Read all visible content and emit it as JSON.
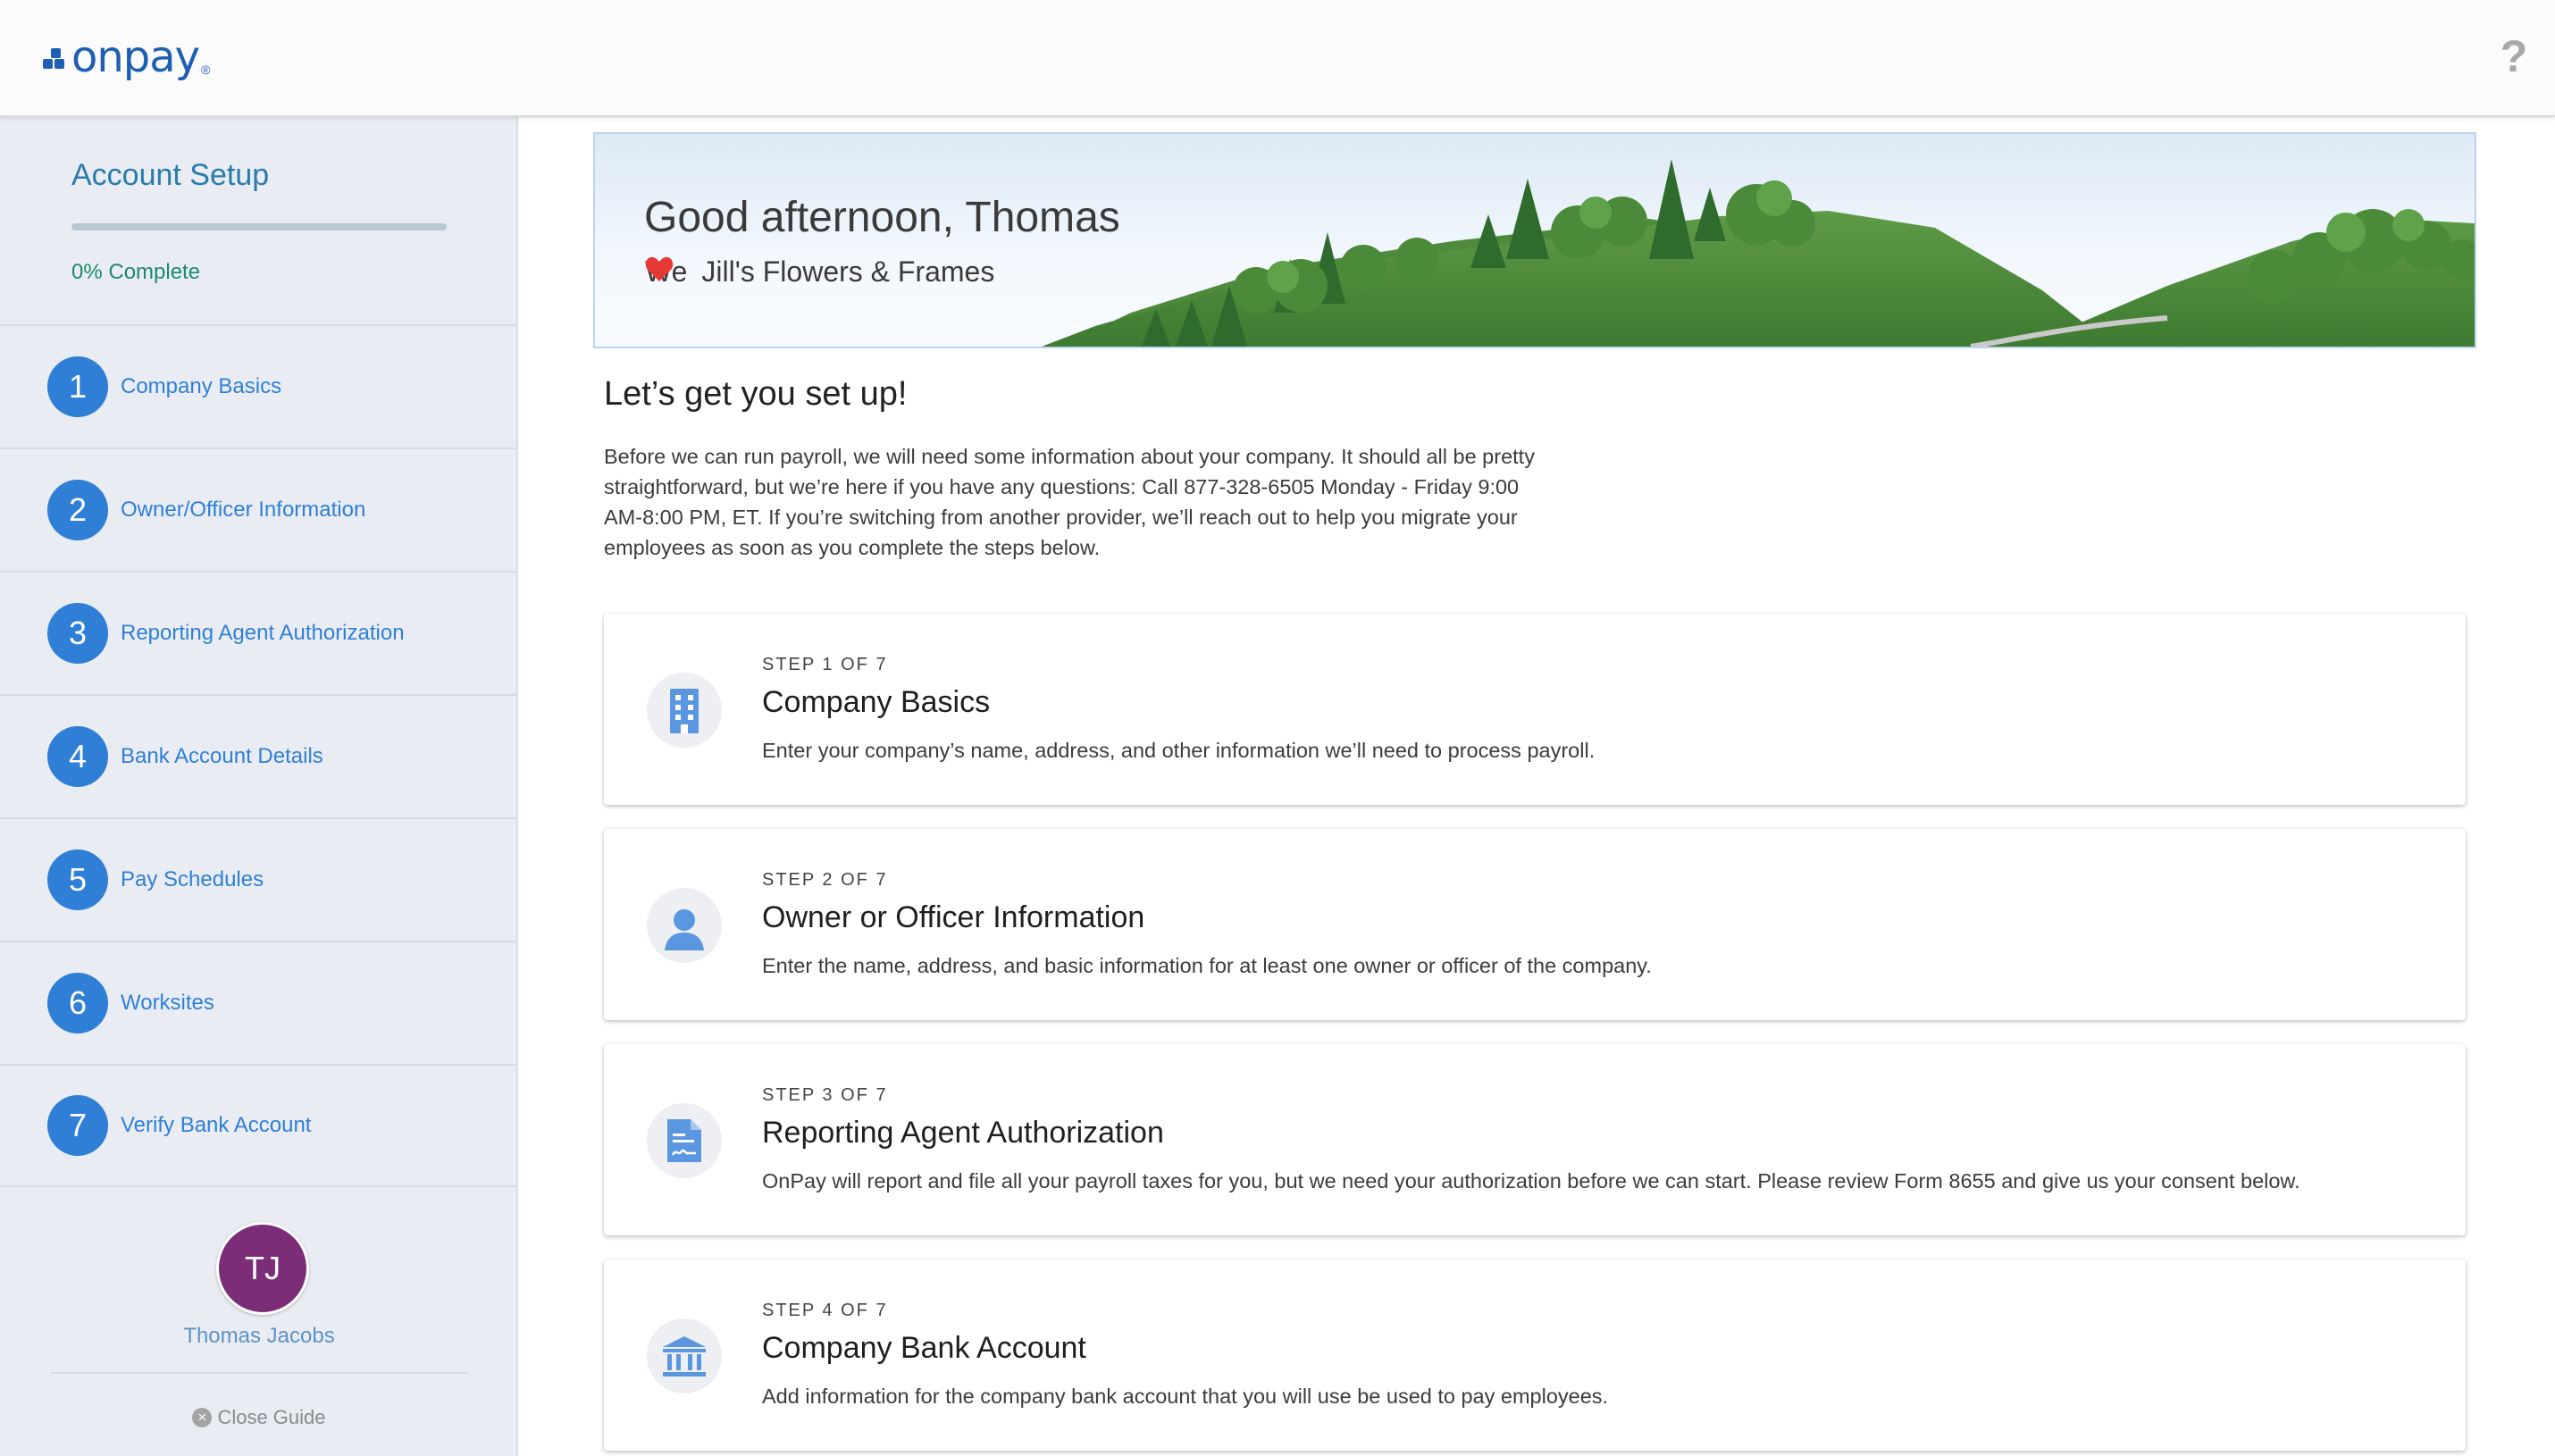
{
  "header": {
    "logo_text": "onpay",
    "logo_mark": "®",
    "help_icon": "?"
  },
  "sidebar": {
    "title": "Account Setup",
    "progress": 0,
    "percent_label": "0% Complete",
    "steps": [
      {
        "num": "1",
        "label": "Company Basics"
      },
      {
        "num": "2",
        "label": "Owner/Officer Information"
      },
      {
        "num": "3",
        "label": "Reporting Agent Authorization"
      },
      {
        "num": "4",
        "label": "Bank Account Details"
      },
      {
        "num": "5",
        "label": "Pay Schedules"
      },
      {
        "num": "6",
        "label": "Worksites"
      },
      {
        "num": "7",
        "label": "Verify Bank Account"
      }
    ],
    "user": {
      "initials": "TJ",
      "name": "Thomas Jacobs"
    },
    "close_guide": "Close Guide"
  },
  "banner": {
    "greeting": "Good afternoon, Thomas",
    "we": "We",
    "company": "Jill's Flowers & Frames"
  },
  "main": {
    "title": "Let’s get you set up!",
    "intro": "Before we can run payroll, we will need some information about your company. It should all be pretty straightforward, but we’re here if you have any questions: Call 877-328-6505 Monday - Friday 9:00 AM-8:00 PM, ET. If you’re switching from another provider, we’ll reach out to help you migrate your employees as soon as you complete the steps below.",
    "cards": [
      {
        "meta": "STEP 1 OF 7",
        "title": "Company Basics",
        "desc": "Enter your company’s name, address, and other information we’ll need to process payroll.",
        "icon": "building-icon"
      },
      {
        "meta": "STEP 2 OF 7",
        "title": "Owner or Officer Information",
        "desc": "Enter the name, address, and basic information for at least one owner or officer of the company.",
        "icon": "person-icon"
      },
      {
        "meta": "STEP 3 OF 7",
        "title": "Reporting Agent Authorization",
        "desc": "OnPay will report and file all your payroll taxes for you, but we need your authorization before we can start. Please review Form 8655 and give us your consent below.",
        "icon": "signed-document-icon"
      },
      {
        "meta": "STEP 4 OF 7",
        "title": "Company Bank Account",
        "desc": "Add information for the company bank account that you will use be used to pay employees.",
        "icon": "bank-icon"
      }
    ]
  },
  "colors": {
    "brand": "#1f5fb3",
    "step_blue": "#2f7fd6",
    "sidebar_bg": "#e9edf3",
    "complete_green": "#1c8a68",
    "avatar": "#7b2d78",
    "heart": "#e53935",
    "icon_blue": "#5a97e0"
  }
}
